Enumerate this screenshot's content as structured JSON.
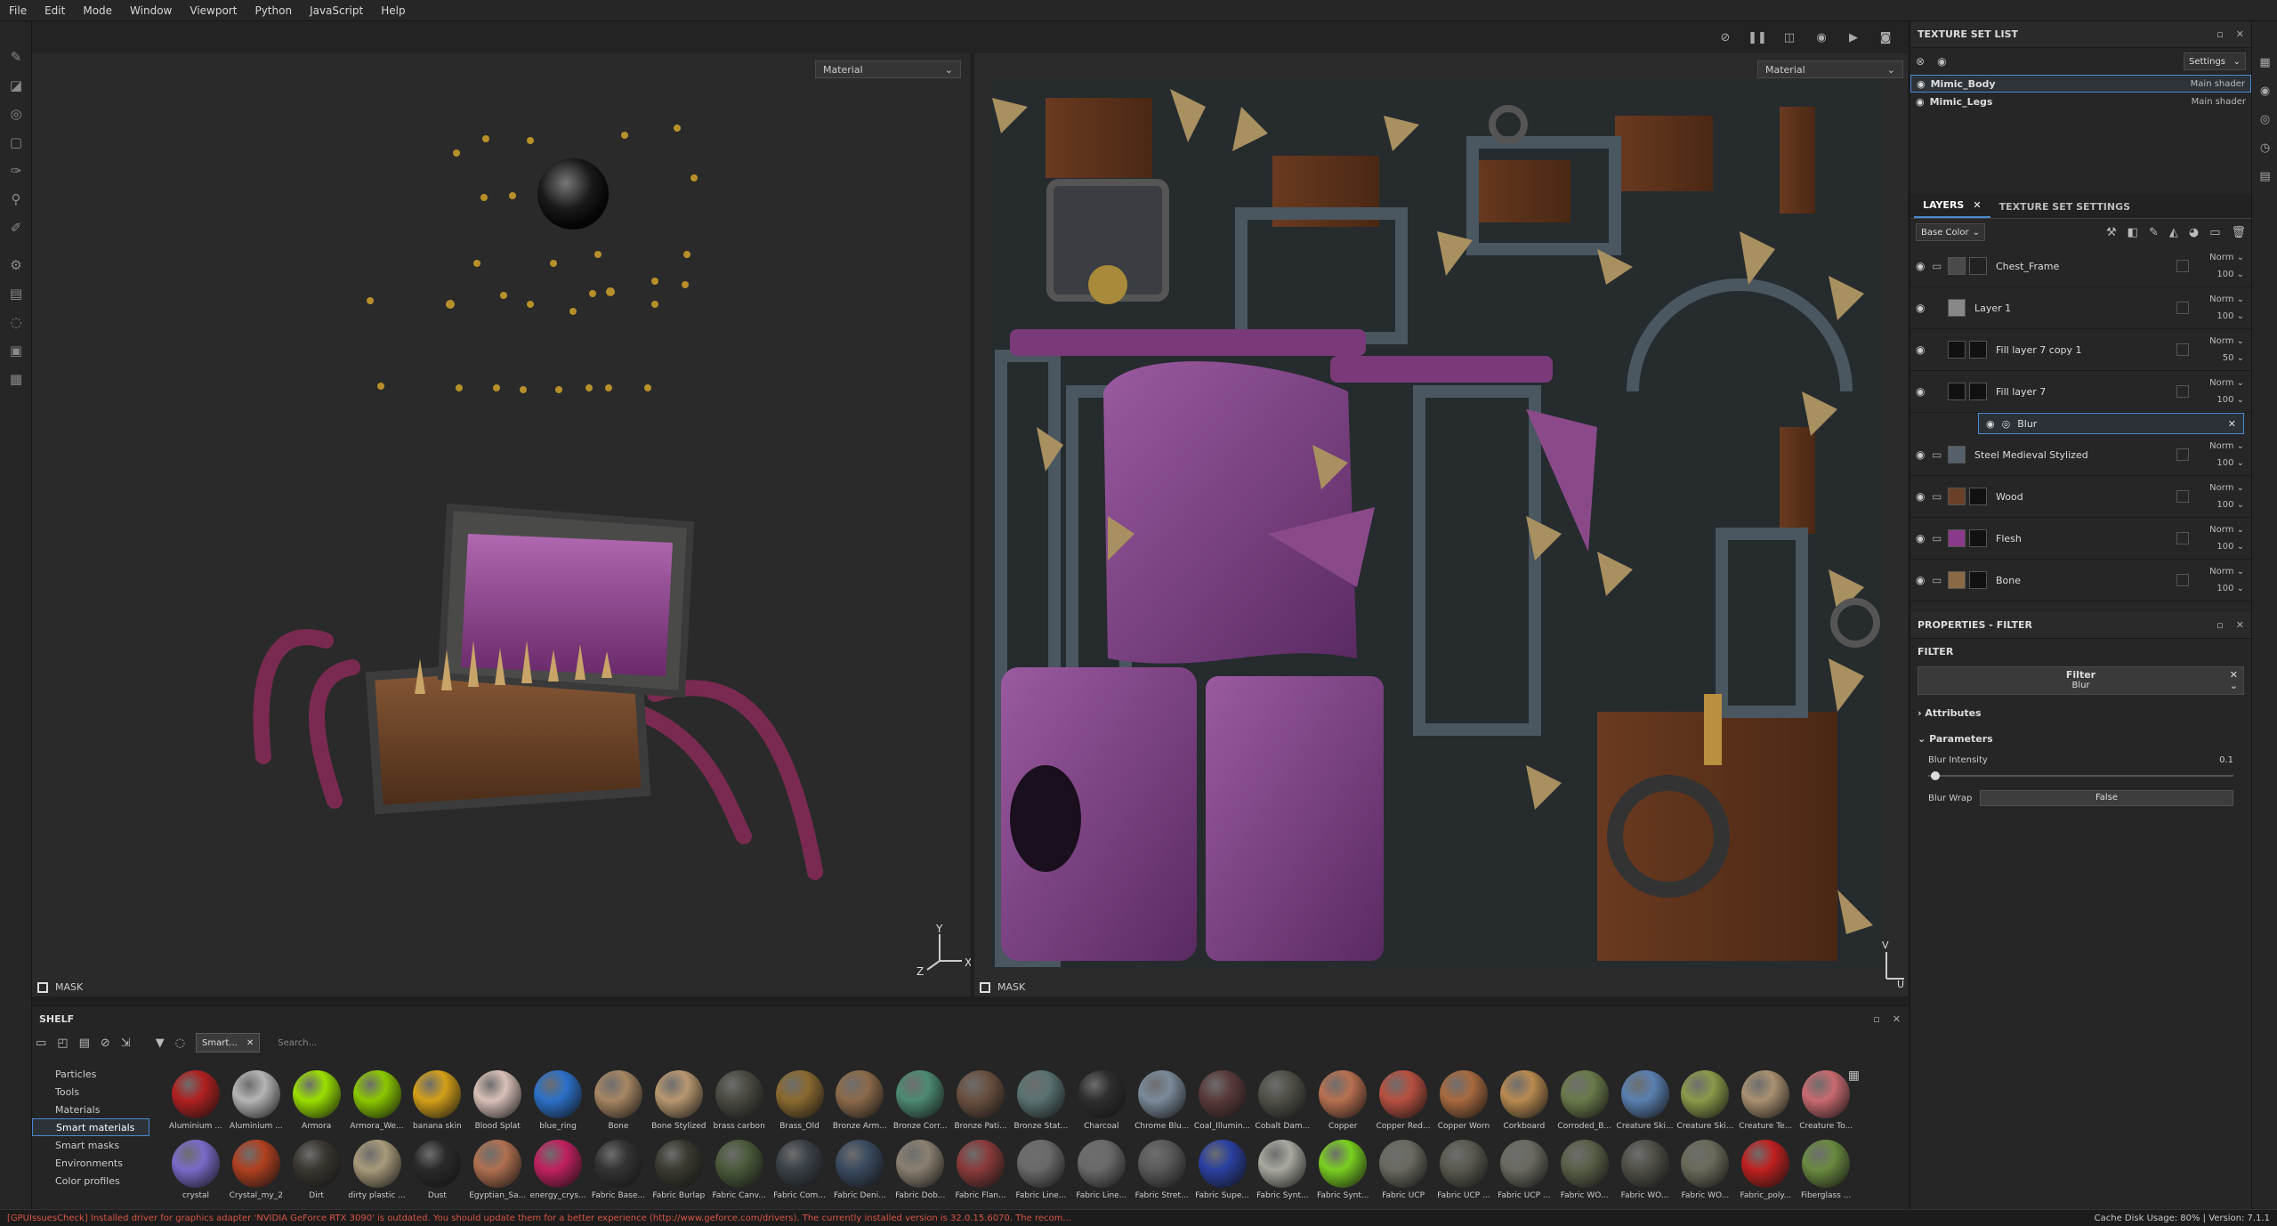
{
  "menu": [
    "File",
    "Edit",
    "Mode",
    "Window",
    "Viewport",
    "Python",
    "JavaScript",
    "Help"
  ],
  "viewport": {
    "left_mode": "Material",
    "right_mode": "Material",
    "left_mask": "MASK",
    "right_mask": "MASK",
    "axis_y": "Y",
    "axis_z": "Z",
    "axis_x": "X",
    "uv_v": "V",
    "uv_u": "U"
  },
  "texture_set_list": {
    "title": "TEXTURE SET LIST",
    "settings_label": "Settings",
    "sets": [
      {
        "name": "Mimic_Body",
        "shader": "Main shader"
      },
      {
        "name": "Mimic_Legs",
        "shader": "Main shader"
      }
    ]
  },
  "layers_panel": {
    "tab_layers": "LAYERS",
    "tab_settings": "TEXTURE SET SETTINGS",
    "channel": "Base Color",
    "layers": [
      {
        "name": "Chest_Frame",
        "blend": "Norm",
        "opacity": "100",
        "thumb": "#4a4a4a",
        "mask": "#222",
        "folder": true
      },
      {
        "name": "Layer 1",
        "blend": "Norm",
        "opacity": "100",
        "thumb": "#888",
        "mask": "",
        "folder": false
      },
      {
        "name": "Fill layer 7 copy 1",
        "blend": "Norm",
        "opacity": "50",
        "thumb": "#111",
        "mask": "#111",
        "folder": false
      },
      {
        "name": "Fill layer 7",
        "blend": "Norm",
        "opacity": "100",
        "thumb": "#111",
        "mask": "#111",
        "folder": false
      },
      {
        "name": "Steel Medieval Stylized",
        "blend": "Norm",
        "opacity": "100",
        "thumb": "#56606a",
        "mask": "",
        "folder": true
      },
      {
        "name": "Wood",
        "blend": "Norm",
        "opacity": "100",
        "thumb": "#6a4128",
        "mask": "#111",
        "folder": true
      },
      {
        "name": "Flesh",
        "blend": "Norm",
        "opacity": "100",
        "thumb": "#8a3a8a",
        "mask": "#111",
        "folder": true
      },
      {
        "name": "Bone",
        "blend": "Norm",
        "opacity": "100",
        "thumb": "#8a6a45",
        "mask": "#111",
        "folder": true
      }
    ],
    "effect": "Blur"
  },
  "properties": {
    "title": "PROPERTIES - FILTER",
    "filter_heading": "FILTER",
    "filter_label": "Filter",
    "filter_value": "Blur",
    "attributes": "Attributes",
    "parameters": "Parameters",
    "blur_intensity_label": "Blur Intensity",
    "blur_intensity_value": "0.1",
    "blur_wrap_label": "Blur Wrap",
    "blur_wrap_value": "False"
  },
  "shelf": {
    "title": "SHELF",
    "tag": "Smart...",
    "search_placeholder": "Search...",
    "categories": [
      "Particles",
      "Tools",
      "Materials",
      "Smart materials",
      "Smart masks",
      "Environments",
      "Color profiles"
    ],
    "active_category": "Smart materials",
    "row1": [
      {
        "label": "Aluminium ...",
        "color": "#b02020"
      },
      {
        "label": "Aluminium ...",
        "color": "#b5b5b5"
      },
      {
        "label": "Armora",
        "color": "#9ae000"
      },
      {
        "label": "Armora_We...",
        "color": "#8bc800"
      },
      {
        "label": "banana skin",
        "color": "#d4a019"
      },
      {
        "label": "Blood Splat",
        "color": "#d9c0b8"
      },
      {
        "label": "blue_ring",
        "color": "#2b70c8"
      },
      {
        "label": "Bone",
        "color": "#a68663"
      },
      {
        "label": "Bone Stylized",
        "color": "#b89870"
      },
      {
        "label": "brass carbon",
        "color": "#4a4a42"
      },
      {
        "label": "Brass_Old",
        "color": "#8a6a30"
      },
      {
        "label": "Bronze Arm...",
        "color": "#8c6a4a"
      },
      {
        "label": "Bronze Corr...",
        "color": "#4d8a72"
      },
      {
        "label": "Bronze Pati...",
        "color": "#6a5040"
      },
      {
        "label": "Bronze Stat...",
        "color": "#5a7272"
      },
      {
        "label": "Charcoal",
        "color": "#2e2e2e"
      },
      {
        "label": "Chrome Blu...",
        "color": "#7a8a9a"
      },
      {
        "label": "Coal_Illumin...",
        "color": "#5a3a3a"
      },
      {
        "label": "Cobalt Dam...",
        "color": "#505048"
      },
      {
        "label": "Copper",
        "color": "#b87050"
      },
      {
        "label": "Copper Red...",
        "color": "#b85040"
      },
      {
        "label": "Copper Worn",
        "color": "#a86a40"
      },
      {
        "label": "Corkboard",
        "color": "#b88a50"
      },
      {
        "label": "Corroded_B...",
        "color": "#6a7a4a"
      },
      {
        "label": "Creature Ski...",
        "color": "#5a80b0"
      },
      {
        "label": "Creature Ski...",
        "color": "#8a9a4a"
      },
      {
        "label": "Creature Te...",
        "color": "#a89070"
      },
      {
        "label": "Creature To...",
        "color": "#c86a70"
      }
    ],
    "row2": [
      {
        "label": "crystal",
        "color": "#7a6ac8"
      },
      {
        "label": "Crystal_my_2",
        "color": "#b04020"
      },
      {
        "label": "Dirt",
        "color": "#3a3630"
      },
      {
        "label": "dirty plastic ...",
        "color": "#a89a7a"
      },
      {
        "label": "Dust",
        "color": "#2a2a2a"
      },
      {
        "label": "Egyptian_Sa...",
        "color": "#b07050"
      },
      {
        "label": "energy_crys...",
        "color": "#c02060"
      },
      {
        "label": "Fabric Base...",
        "color": "#333"
      },
      {
        "label": "Fabric Burlap",
        "color": "#3a3a30"
      },
      {
        "label": "Fabric Canv...",
        "color": "#4a5a3a"
      },
      {
        "label": "Fabric Com...",
        "color": "#3a4048"
      },
      {
        "label": "Fabric Deni...",
        "color": "#3a4a60"
      },
      {
        "label": "Fabric Dob...",
        "color": "#8a8070"
      },
      {
        "label": "Fabric Flan...",
        "color": "#8a3a3a"
      },
      {
        "label": "Fabric Line...",
        "color": "#6a6a6a"
      },
      {
        "label": "Fabric Line...",
        "color": "#6a6a6a"
      },
      {
        "label": "Fabric Stret...",
        "color": "#5a5a5a"
      },
      {
        "label": "Fabric Supe...",
        "color": "#2a40a0"
      },
      {
        "label": "Fabric Synt...",
        "color": "#a8a8a0"
      },
      {
        "label": "Fabric Synt...",
        "color": "#7ad020"
      },
      {
        "label": "Fabric UCP",
        "color": "#6a6a60"
      },
      {
        "label": "Fabric UCP ...",
        "color": "#5a5a50"
      },
      {
        "label": "Fabric UCP ...",
        "color": "#6a6a60"
      },
      {
        "label": "Fabric WO...",
        "color": "#5a6048"
      },
      {
        "label": "Fabric WO...",
        "color": "#505048"
      },
      {
        "label": "Fabric WO...",
        "color": "#6a6a5a"
      },
      {
        "label": "Fabric_poly...",
        "color": "#c02020"
      },
      {
        "label": "Fiberglass ...",
        "color": "#6a8a40"
      }
    ]
  },
  "status": {
    "error": "[GPUIssuesCheck] Installed driver for graphics adapter 'NVIDIA GeForce RTX 3090' is outdated. You should update them for a better experience (http://www.geforce.com/drivers). The currently installed version is 32.0.15.6070. The recom...",
    "info": "Cache Disk Usage:   80% | Version: 7.1.1"
  }
}
